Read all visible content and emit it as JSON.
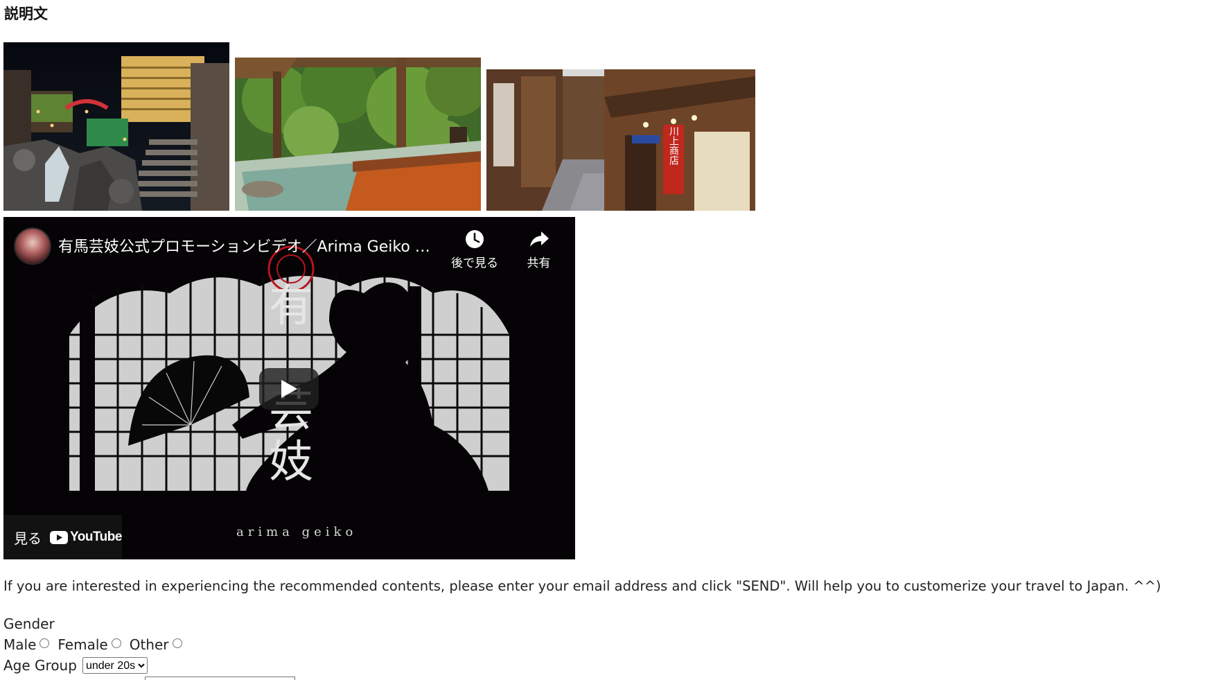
{
  "heading": "説明文",
  "photos": [
    {
      "name": "onsen-town-night-photo"
    },
    {
      "name": "open-air-bath-photo"
    },
    {
      "name": "old-street-photo",
      "shop_sign": "川上商店"
    }
  ],
  "video": {
    "title": "有馬芸妓公式プロモーションビデオ／Arima Geiko O...",
    "watch_later_label": "後で見る",
    "share_label": "共有",
    "watch_on_label": "見る",
    "platform_label": "YouTube",
    "vertical_text": [
      "有",
      "芸",
      "妓"
    ],
    "bottom_caption": "arima geiko"
  },
  "intro_text": "If you are interested in experiencing the recommended contents, please enter your email address and click \"SEND\". Will help you to customerize your travel to Japan. ^^)",
  "form": {
    "gender_label": "Gender",
    "gender_options": [
      "Male",
      "Female",
      "Other"
    ],
    "age_label": "Age Group",
    "age_selected": "under 20s"
  },
  "colors": {
    "youtube_red": "#ff0000",
    "stamp_red": "#b8141e"
  }
}
